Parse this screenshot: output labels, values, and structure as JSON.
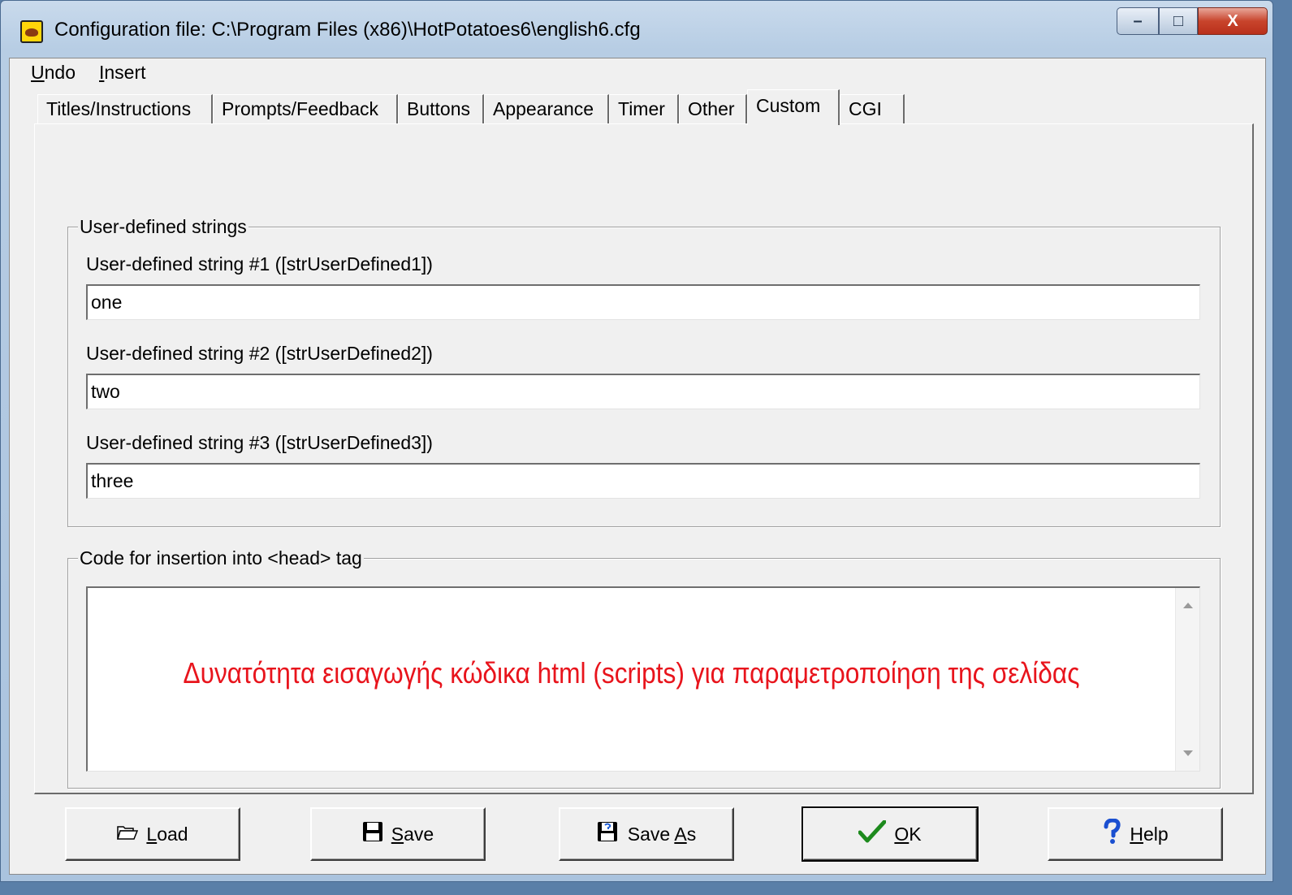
{
  "window": {
    "title": "Configuration file: C:\\Program Files (x86)\\HotPotatoes6\\english6.cfg",
    "min_glyph": "–",
    "max_glyph": "□",
    "close_glyph": "X"
  },
  "menu": {
    "undo_first": "U",
    "undo_rest": "ndo",
    "insert_first": "I",
    "insert_rest": "nsert"
  },
  "tabs": [
    {
      "label": "Titles/Instructions"
    },
    {
      "label": "Prompts/Feedback"
    },
    {
      "label": "Buttons"
    },
    {
      "label": "Appearance"
    },
    {
      "label": "Timer"
    },
    {
      "label": "Other"
    },
    {
      "label": "Custom",
      "active": true
    },
    {
      "label": "CGI"
    }
  ],
  "user_strings": {
    "group_label": "User-defined strings",
    "fields": [
      {
        "label": "User-defined string #1 ([strUserDefined1])",
        "value": "one"
      },
      {
        "label": "User-defined string #2 ([strUserDefined2])",
        "value": "two"
      },
      {
        "label": "User-defined string #3 ([strUserDefined3])",
        "value": "three"
      }
    ]
  },
  "head_code": {
    "group_label": "Code for insertion into <head> tag",
    "annotation": "Δυνατότητα εισαγωγής κώδικα html (scripts) για παραμετροποίηση της σελίδας",
    "annotation_color": "#e8141c"
  },
  "buttons": {
    "load_first": "L",
    "load_rest": "oad",
    "save_first": "S",
    "save_rest": "ave",
    "saveas_pre": "Save ",
    "saveas_ul": "A",
    "saveas_rest": "s",
    "ok_first": "O",
    "ok_rest": "K",
    "help_first": "H",
    "help_rest": "elp"
  }
}
